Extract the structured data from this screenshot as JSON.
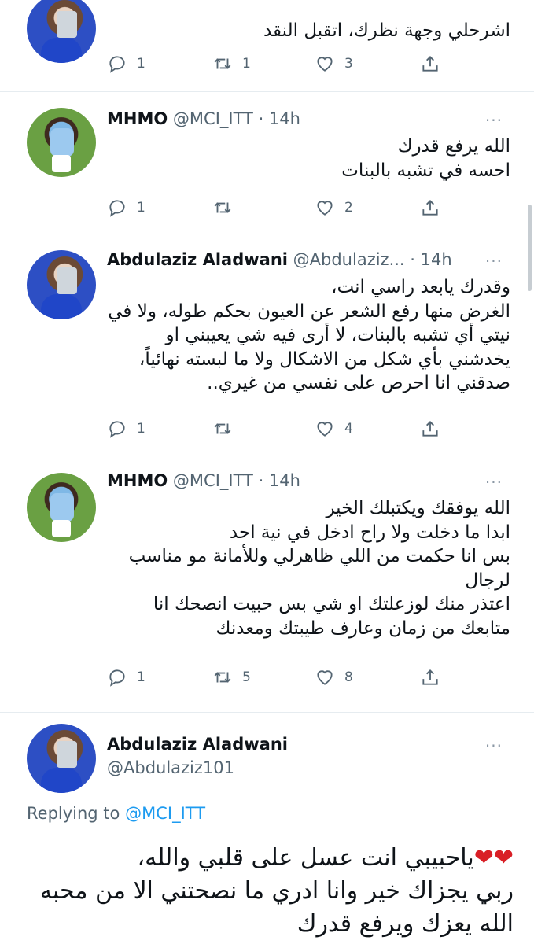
{
  "tweets": [
    {
      "text": "اشرحلي وجهة نظرك، اتقبل النقد",
      "replies": "1",
      "retweets": "1",
      "likes": "3"
    },
    {
      "name": "MHMO",
      "handle": "@MCI_ITT",
      "time": "· 14h",
      "text": "الله يرفع قدرك\nاحسه في تشبه بالبنات",
      "replies": "1",
      "retweets": "",
      "likes": "2"
    },
    {
      "name": "Abdulaziz Aladwani",
      "handle": "@Abdulaziz...",
      "time": "· 14h",
      "text": "وقدرك يابعد راسي انت،\nالغرض منها رفع الشعر عن العيون بحكم طوله، ولا في نيتي أي تشبه بالبنات، لا أرى فيه شي يعيبني او يخدشني بأي شكل من الاشكال ولا ما لبسته نهائياً، صدقني انا احرص على نفسي من غيري..",
      "replies": "1",
      "retweets": "",
      "likes": "4"
    },
    {
      "name": "MHMO",
      "handle": "@MCI_ITT",
      "time": "· 14h",
      "text": "الله يوفقك ويكتبلك الخير\nابدا ما دخلت ولا راح ادخل في نية احد\nبس انا حكمت من اللي ظاهرلي وللأمانة مو مناسب لرجال\nاعتذر منك لوزعلتك او شي بس حبيت انصحك انا متابعك من زمان وعارف طيبتك ومعدنك",
      "replies": "1",
      "retweets": "5",
      "likes": "8"
    }
  ],
  "main_tweet": {
    "name": "Abdulaziz Aladwani",
    "handle": "@Abdulaziz101",
    "replying_prefix": "Replying to",
    "replying_to": "@MCI_ITT",
    "text": "ياحبيبي انت عسل على قلبي والله،\nربي يجزاك خير وانا ادري ما نصحتني الا من محبه الله يعزك ويرفع قدرك",
    "hearts": "❤❤"
  },
  "more_label": "···",
  "colors": {
    "accent": "#1d9bf0",
    "secondary_text": "#536471",
    "heart": "#d91f26"
  },
  "icons": [
    "reply-icon",
    "retweet-icon",
    "like-icon",
    "share-icon",
    "more-icon"
  ]
}
